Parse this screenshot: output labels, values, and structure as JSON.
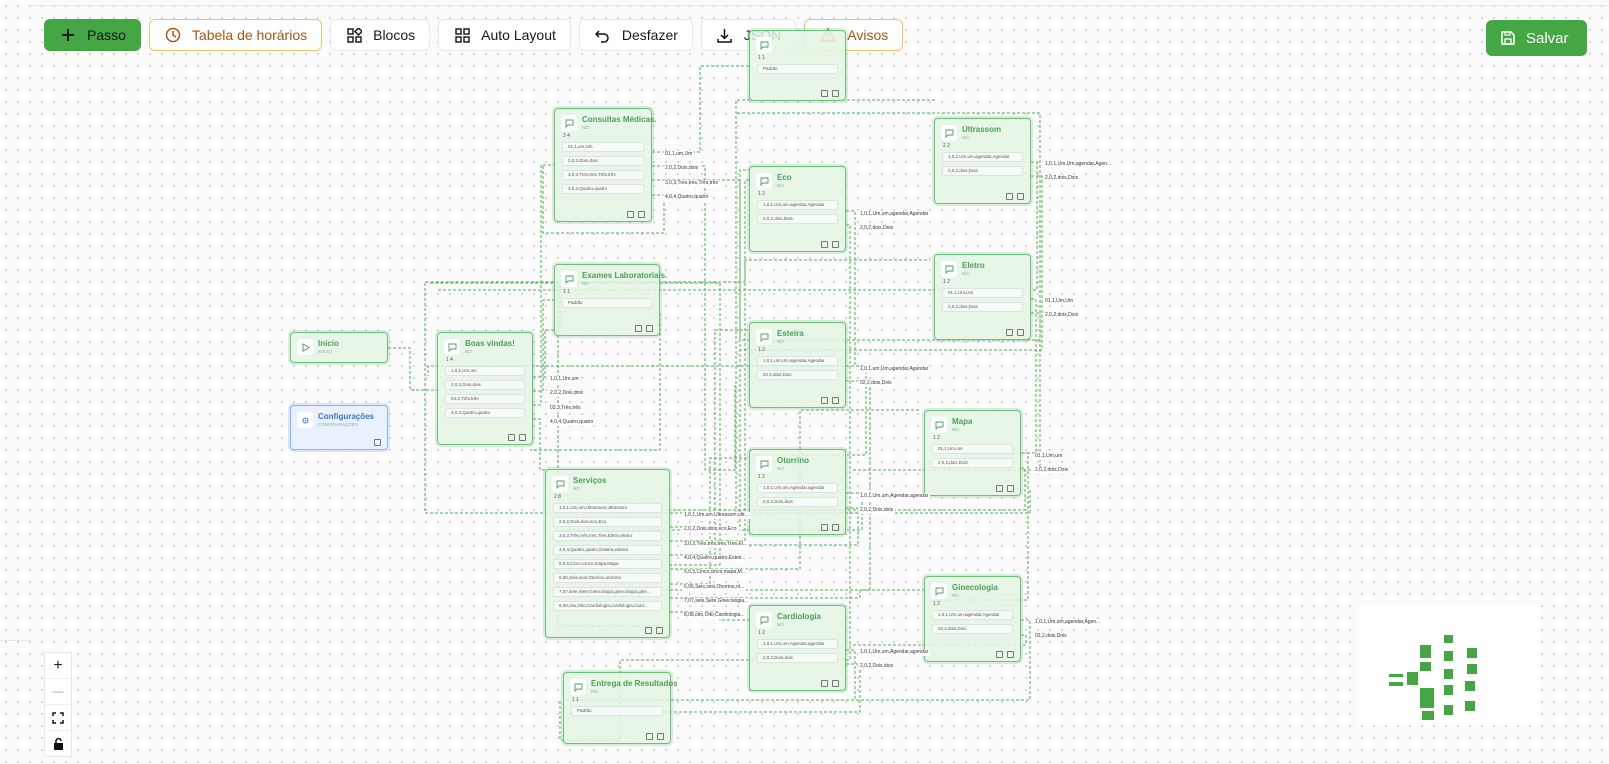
{
  "toolbar": {
    "step": "Passo",
    "schedule": "Tabela de horários",
    "blocks": "Blocos",
    "auto_layout": "Auto Layout",
    "undo": "Desfazer",
    "json": "JSON",
    "warnings": "Avisos"
  },
  "save": "Salvar",
  "nodes": {
    "inicio": {
      "title": "Início",
      "sub": "INÍCIO"
    },
    "config": {
      "title": "Configurações",
      "sub": "CONFIGURAÇÕES"
    },
    "boas": {
      "title": "Boas vindas!",
      "sub": "NÓ",
      "counts": "1  4",
      "rows": [
        "1,0,1,Um,um",
        "2,0,2,Dois,dois",
        "03,3,Três,três",
        "4,0,4,Quatro,quatro"
      ]
    },
    "consultas": {
      "title": "Consultas Médicas.",
      "sub": "NÓ",
      "counts": "2  4",
      "rows": [
        "01,1,um,Um",
        "2,0,2,Dois,dois",
        "3,0,3,Tres,tres,Três,três",
        "4,0,4,Quatro,quatro"
      ]
    },
    "exames": {
      "title": "Exames Laboratoriais.",
      "sub": "NÓ",
      "counts": "1  1",
      "rows": [
        "Padrão"
      ]
    },
    "servicos": {
      "title": "Serviços",
      "sub": "NÓ",
      "counts": "2  8",
      "rows": [
        "1,0,1,Um,um,Ultrassom,ultrassom",
        "2,0,2,Dois,dois,eco,Eco",
        "3,0,3,Três,três,tres,Tres,Eletro,eletro",
        "4,0,4,Quatro,quatro,Esteira,esteira",
        "5,0,5,Cinco,cinco,mapa,Mapa",
        "6,06,Seis,seis,Otorrino,otorrino",
        "7,07,sete,Sete,Ginecologia,ginecologia,gine...",
        "8,08,oito,Oito,Cardiologia,cardiologia,Card..."
      ]
    },
    "entrega": {
      "title": "Entrega de Resultados",
      "sub": "NÓ",
      "counts": "1  1",
      "rows": [
        "Padrão"
      ]
    },
    "topnode": {
      "title": "",
      "sub": "",
      "counts": "1  1",
      "rows": [
        "Padrão"
      ]
    },
    "eco": {
      "title": "Eco",
      "sub": "NÓ",
      "counts": "1  2",
      "rows": [
        "1,0,1,Um,um,agendar,Agendar",
        "2,0,2,dois,Dois"
      ]
    },
    "esteira": {
      "title": "Esteira",
      "sub": "NÓ",
      "counts": "1  2",
      "rows": [
        "1,0,1,um,Um,agendar,Agendar",
        "02,2,dois,Dois"
      ]
    },
    "otorrino": {
      "title": "Otorrino",
      "sub": "NÓ",
      "counts": "1  2",
      "rows": [
        "1,0,1,Um,um,Agendar,agendar",
        "2,0,2,Dois,dois"
      ]
    },
    "cardiologia": {
      "title": "Cardiologia",
      "sub": "NÓ",
      "counts": "1  2",
      "rows": [
        "1,0,1,Um,um,Agendar,agendar",
        "2,0,2,Dois,dois"
      ]
    },
    "ultrassom": {
      "title": "Ultrassom",
      "sub": "NÓ",
      "counts": "2  2",
      "rows": [
        "1,0,1,Um,um,agendar,Agendar",
        "2,0,2,dois,Dois"
      ]
    },
    "eletro": {
      "title": "Eletro",
      "sub": "NÓ",
      "counts": "1  2",
      "rows": [
        "01,1,Um,Um",
        "2,0,2,dois,Dois"
      ]
    },
    "mapa": {
      "title": "Mapa",
      "sub": "NÓ",
      "counts": "1  2",
      "rows": [
        "01,1,Um,um",
        "2,0,2,dois,Dois"
      ]
    },
    "ginecologia": {
      "title": "Ginecologia",
      "sub": "NÓ",
      "counts": "1  2",
      "rows": [
        "1,0,1,Um,um,agendar,Agendar",
        "02,2,dois,Dois"
      ]
    }
  },
  "edge_labels": {
    "boas": [
      "1,0,1,Um,um",
      "2,0,2,Dois,dois",
      "03,3,Três,três",
      "4,0,4,Quatro,quatro"
    ],
    "consultas": [
      "01,1,um,Um",
      "2,0,2,Dois,dois",
      "3,0,3,Tres,tres,Três,três",
      "4,0,4,Quatro,quatro"
    ],
    "servicos": [
      "1,0,1,Um,um,Ultrassom,ultr...",
      "2,0,2,Dois,dois,eco,Eco",
      "3,0,2,Três,três,tres,Tres,El...",
      "4,0,4,Quatro,quatro,Esteir...",
      "5,0,5,Cinco,cinco,mapa,M...",
      "6,06,Seis,seis,Otorrino,ot...",
      "7,07,sete,Sete,Ginecologia...",
      "8,08,oito,Oito,Cardiologia..."
    ],
    "eco": [
      "1,0,1,Um,um,agendar,Agendar",
      "2,0,2,dois,Dois"
    ],
    "esteira": [
      "1,0,1,um,Um,agendar,Agendar",
      "02,2,dois,Dois"
    ],
    "otorrino": [
      "1,0,1,Um,um,Agendar,agendar",
      "2,0,2,Dois,dois"
    ],
    "cardiologia": [
      "1,0,1,Um,um,Agendar,agendar",
      "2,0,2,Dois,dois"
    ],
    "ultrassom": [
      "1,0,1,Um,Um,agendar,Agen...",
      "2,0,2,dois,Dois"
    ],
    "eletro": [
      "01,1,Um,Um",
      "2,0,2,dois,Dois"
    ],
    "mapa": [
      "01,1,Um,um",
      "2,0,2,dois,Dois"
    ],
    "ginecologia": [
      "1,0,1,Um,um,agendar,Agen...",
      "02,2,dois,Dois"
    ]
  },
  "zoom": {
    "in": "+",
    "out": "—"
  },
  "colors": {
    "accent": "#45a744",
    "warning": "#f0c26b",
    "config": "#8ab6f5"
  }
}
